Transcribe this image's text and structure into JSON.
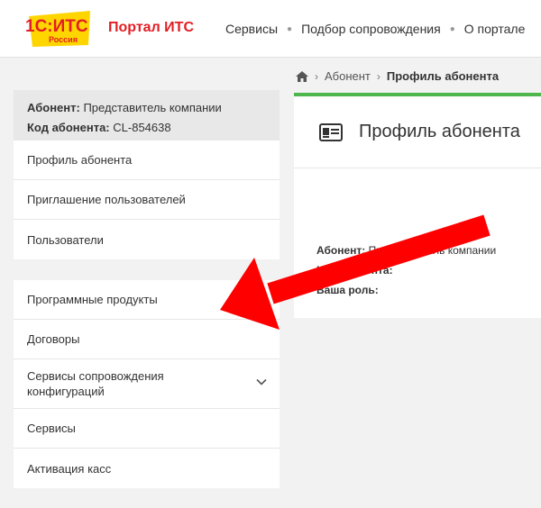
{
  "header": {
    "logo_text": "1С:ИТС",
    "logo_sub": "Россия",
    "portal_title": "Портал ИТС",
    "nav": [
      "Сервисы",
      "Подбор сопровождения",
      "О портале"
    ]
  },
  "breadcrumb": {
    "item": "Абонент",
    "current": "Профиль абонента"
  },
  "account": {
    "subscriber_label": "Абонент:",
    "subscriber_value": "Представитель компании",
    "code_label": "Код абонента:",
    "code_value": "CL-854638"
  },
  "sidebar": {
    "group1": [
      "Профиль абонента",
      "Приглашение пользователей",
      "Пользователи"
    ],
    "group2": [
      "Программные продукты",
      "Договоры",
      "Сервисы сопровождения конфигураций",
      "Сервисы",
      "Активация касс"
    ]
  },
  "profile_card": {
    "title": "Профиль абонента",
    "subscriber_label": "Абонент:",
    "subscriber_value": "Представитель компании",
    "code_label": "Код абонента:",
    "role_label": "Ваша роль:"
  },
  "colors": {
    "brand_red": "#e31e24",
    "brand_yellow": "#ffd500",
    "accent_green": "#4db74d",
    "arrow_red": "#ff0000"
  }
}
